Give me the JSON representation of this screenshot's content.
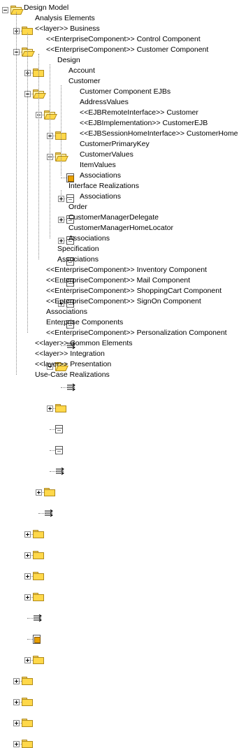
{
  "tree": [
    {
      "label": "Design Model",
      "icon": "folder-open-icon",
      "level": 0,
      "toggle": "minus"
    },
    {
      "label": "Analysis Elements",
      "icon": "folder-icon",
      "level": 1,
      "toggle": "plus"
    },
    {
      "label": "<<layer>> Business",
      "icon": "folder-open-icon",
      "level": 1,
      "toggle": "minus"
    },
    {
      "label": "<<EnterpriseComponent>> Control Component",
      "icon": "folder-icon",
      "level": 2,
      "toggle": "plus"
    },
    {
      "label": "<<EnterpriseComponent>> Customer Component",
      "icon": "folder-open-icon",
      "level": 2,
      "toggle": "minus"
    },
    {
      "label": "Design",
      "icon": "folder-open-icon",
      "level": 3,
      "toggle": "minus"
    },
    {
      "label": "Account",
      "icon": "folder-icon",
      "level": 4,
      "toggle": "plus"
    },
    {
      "label": "Customer",
      "icon": "folder-open-icon",
      "level": 4,
      "toggle": "minus"
    },
    {
      "label": "Customer Component EJBs",
      "icon": "component-diagram-icon",
      "level": 5,
      "toggle": ""
    },
    {
      "label": "AddressValues",
      "icon": "class-icon",
      "level": 5,
      "toggle": "plus"
    },
    {
      "label": "<<EJBRemoteInterface>> Customer",
      "icon": "class-icon",
      "level": 5,
      "toggle": "plus"
    },
    {
      "label": "<<EJBImplementation>> CustomerEJB",
      "icon": "class-icon",
      "level": 5,
      "toggle": "plus"
    },
    {
      "label": "<<EJBSessionHomeInterface>> CustomerHome",
      "icon": "class-icon",
      "level": 5,
      "toggle": ""
    },
    {
      "label": "CustomerPrimaryKey",
      "icon": "class-icon",
      "level": 5,
      "toggle": ""
    },
    {
      "label": "CustomerValues",
      "icon": "class-icon",
      "level": 5,
      "toggle": "plus"
    },
    {
      "label": "ItemValues",
      "icon": "class-icon",
      "level": 5,
      "toggle": ""
    },
    {
      "label": "Associations",
      "icon": "associations-icon",
      "level": 5,
      "toggle": ""
    },
    {
      "label": "Interface Realizations",
      "icon": "folder-open-icon",
      "level": 4,
      "toggle": "minus"
    },
    {
      "label": "Associations",
      "icon": "associations-icon",
      "level": 5,
      "toggle": ""
    },
    {
      "label": "Order",
      "icon": "folder-icon",
      "level": 4,
      "toggle": "plus"
    },
    {
      "label": "CustomerManagerDelegate",
      "icon": "class-icon",
      "level": 4,
      "toggle": ""
    },
    {
      "label": "CustomerManagerHomeLocator",
      "icon": "class-icon",
      "level": 4,
      "toggle": ""
    },
    {
      "label": "Associations",
      "icon": "associations-icon",
      "level": 4,
      "toggle": ""
    },
    {
      "label": "Specification",
      "icon": "folder-icon",
      "level": 3,
      "toggle": "plus"
    },
    {
      "label": "Associations",
      "icon": "associations-icon",
      "level": 3,
      "toggle": ""
    },
    {
      "label": "<<EnterpriseComponent>> Inventory Component",
      "icon": "folder-icon",
      "level": 2,
      "toggle": "plus"
    },
    {
      "label": "<<EnterpriseComponent>> Mail Component",
      "icon": "folder-icon",
      "level": 2,
      "toggle": "plus"
    },
    {
      "label": "<<EnterpriseComponent>> ShoppingCart Component",
      "icon": "folder-icon",
      "level": 2,
      "toggle": "plus"
    },
    {
      "label": "<<EnterpriseComponent>> SignOn Component",
      "icon": "folder-icon",
      "level": 2,
      "toggle": "plus"
    },
    {
      "label": "Associations",
      "icon": "associations-icon",
      "level": 2,
      "toggle": ""
    },
    {
      "label": "Enterprise Components",
      "icon": "component-diagram-icon",
      "level": 2,
      "toggle": ""
    },
    {
      "label": "<<EnterpriseComponent>> Personalization Component",
      "icon": "folder-icon",
      "level": 2,
      "toggle": "plus"
    },
    {
      "label": "<<layer>> Common Elements",
      "icon": "folder-icon",
      "level": 1,
      "toggle": "plus"
    },
    {
      "label": "<<layer>> Integration",
      "icon": "folder-icon",
      "level": 1,
      "toggle": "plus"
    },
    {
      "label": "<<layer>> Presentation",
      "icon": "folder-icon",
      "level": 1,
      "toggle": "plus"
    },
    {
      "label": "Use-Case Realizations",
      "icon": "folder-icon",
      "level": 1,
      "toggle": "plus"
    }
  ],
  "colors": {
    "folder": "#ffd84a",
    "connector": "#888888",
    "background": "#ffffff"
  }
}
